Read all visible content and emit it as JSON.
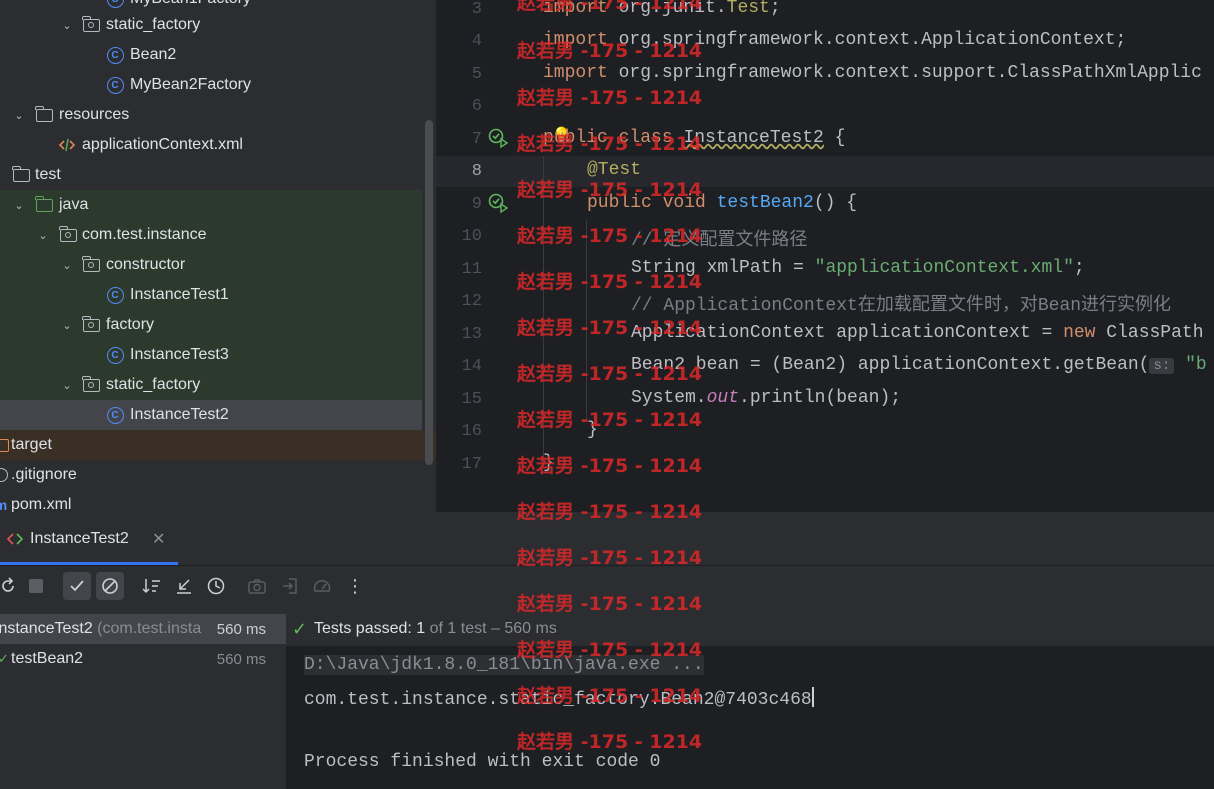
{
  "project_tree": {
    "items": [
      {
        "label": "MyBean1Factory",
        "kind": "class"
      },
      {
        "label": "static_factory",
        "kind": "package"
      },
      {
        "label": "Bean2",
        "kind": "class"
      },
      {
        "label": "MyBean2Factory",
        "kind": "class"
      },
      {
        "label": "resources",
        "kind": "resources-folder"
      },
      {
        "label": "applicationContext.xml",
        "kind": "xml-file"
      },
      {
        "label": "test",
        "kind": "folder"
      },
      {
        "label": "java",
        "kind": "test-source-folder"
      },
      {
        "label": "com.test.instance",
        "kind": "package"
      },
      {
        "label": "constructor",
        "kind": "package"
      },
      {
        "label": "InstanceTest1",
        "kind": "class"
      },
      {
        "label": "factory",
        "kind": "package"
      },
      {
        "label": "InstanceTest3",
        "kind": "class"
      },
      {
        "label": "static_factory",
        "kind": "package"
      },
      {
        "label": "InstanceTest2",
        "kind": "class",
        "selected": true
      },
      {
        "label": "target",
        "kind": "excluded-folder"
      },
      {
        "label": ".gitignore",
        "kind": "file"
      },
      {
        "label": "pom.xml",
        "kind": "maven-file"
      }
    ]
  },
  "editor": {
    "line_numbers": [
      "3",
      "4",
      "5",
      "6",
      "7",
      "8",
      "9",
      "10",
      "11",
      "12",
      "13",
      "14",
      "15",
      "16",
      "17"
    ],
    "current_line": "8",
    "code": {
      "l3_kw": "import",
      "l3_pkg": " org.junit.",
      "l3_cls": "Test",
      "l3_end": ";",
      "l4_kw": "import",
      "l4_rest": " org.springframework.context.ApplicationContext;",
      "l5_kw": "import",
      "l5_rest": " org.springframework.context.support.ClassPathXmlApplic",
      "l7_kw1": "public",
      "l7_kw2": " class ",
      "l7_name": "InstanceTest2",
      "l7_end": " {",
      "l8_ann": "@Test",
      "l9_kw1": "public",
      "l9_kw2": " void ",
      "l9_fn": "testBean2",
      "l9_end": "() {",
      "l10_cmt": "// 定义配置文件路径",
      "l11_a": "String xmlPath = ",
      "l11_str": "\"applicationContext.xml\"",
      "l11_end": ";",
      "l12_cmt": "// ApplicationContext在加载配置文件时，对Bean进行实例化",
      "l13_a": "ApplicationContext applicationContext = ",
      "l13_kw": "new",
      "l13_b": " ClassPath",
      "l14_a": "Bean2 bean = (Bean2) applicationContext.getBean(",
      "l14_hint": "s:",
      "l14_str": " \"b",
      "l15_a": "System.",
      "l15_fld": "out",
      "l15_b": ".println(bean);",
      "l16": "}",
      "l17": "}"
    }
  },
  "run_window": {
    "tab_label": "InstanceTest2",
    "tree": [
      {
        "label": "InstanceTest2",
        "pkg": " (com.test.insta",
        "duration": "560 ms"
      },
      {
        "label": "testBean2",
        "duration": "560 ms"
      }
    ],
    "status": {
      "prefix": "Tests passed: ",
      "passed": "1",
      "suffix": " of 1 test – 560 ms"
    },
    "console": {
      "command": "D:\\Java\\jdk1.8.0_181\\bin\\java.exe ...",
      "output": "com.test.instance.static_factory.Bean2@7403c468",
      "exit": "Process finished with exit code 0"
    },
    "toolbar_icons": [
      "rerun-icon",
      "stop-icon",
      "show-passed-icon",
      "show-ignored-icon",
      "sort-icon",
      "collapse-icon",
      "history-icon",
      "camera-icon",
      "export-icon",
      "speedometer-icon",
      "more-icon"
    ]
  },
  "watermark": "赵若男 -175 - 1214",
  "colors": {
    "accent": "#3574f0",
    "success": "#5fb85c",
    "watermark": "#dc2828"
  }
}
